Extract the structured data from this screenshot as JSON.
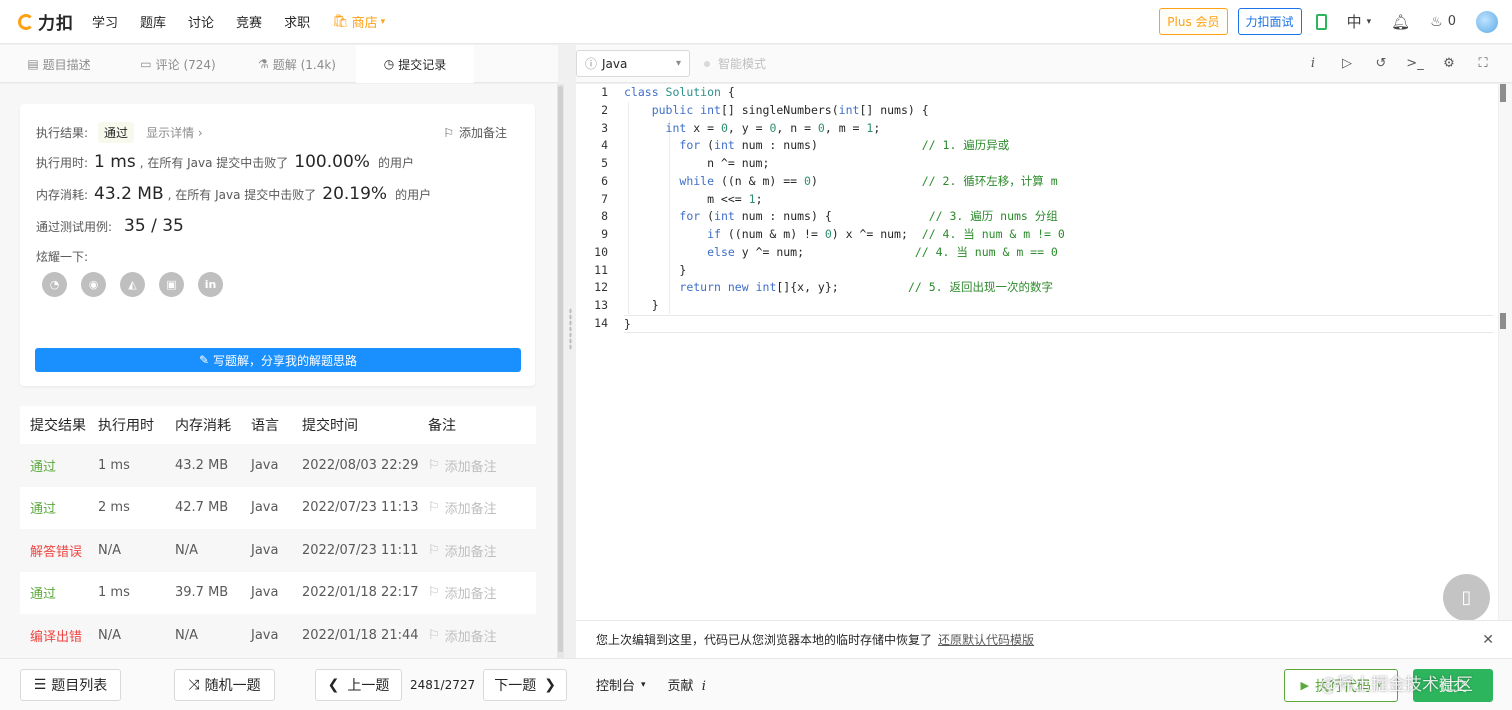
{
  "nav": {
    "logo_text": "力扣",
    "links": [
      "学习",
      "题库",
      "讨论",
      "竞赛",
      "求职"
    ],
    "store": "商店",
    "plus": "Plus 会员",
    "interview": "力扣面试",
    "lang": "中",
    "streak": "0"
  },
  "left_tabs": [
    {
      "label": "题目描述"
    },
    {
      "label": "评论 (724)"
    },
    {
      "label": "题解 (1.4k)"
    },
    {
      "label": "提交记录"
    }
  ],
  "result": {
    "result_label": "执行结果:",
    "status": "通过",
    "show_detail": "显示详情 ›",
    "add_note": "添加备注",
    "time_label": "执行用时:",
    "time_value": "1 ms",
    "time_text": ", 在所有 Java 提交中击败了",
    "time_pct": "100.00%",
    "time_suffix": "的用户",
    "mem_label": "内存消耗:",
    "mem_value": "43.2 MB",
    "mem_text": ", 在所有 Java 提交中击败了",
    "mem_pct": "20.19%",
    "mem_suffix": "的用户",
    "tests_label": "通过测试用例:",
    "tests_value": "35 / 35",
    "share_label": "炫耀一下:",
    "write_solution": "写题解，分享我的解题思路"
  },
  "submissions": {
    "headers": [
      "提交结果",
      "执行用时",
      "内存消耗",
      "语言",
      "提交时间",
      "备注"
    ],
    "rows": [
      {
        "status": "通过",
        "time": "1 ms",
        "mem": "43.2 MB",
        "lang": "Java",
        "date": "2022/08/03 22:29",
        "note": "添加备注"
      },
      {
        "status": "通过",
        "time": "2 ms",
        "mem": "42.7 MB",
        "lang": "Java",
        "date": "2022/07/23 11:13",
        "note": "添加备注"
      },
      {
        "status": "解答错误",
        "time": "N/A",
        "mem": "N/A",
        "lang": "Java",
        "date": "2022/07/23 11:11",
        "note": "添加备注"
      },
      {
        "status": "通过",
        "time": "1 ms",
        "mem": "39.7 MB",
        "lang": "Java",
        "date": "2022/01/18 22:17",
        "note": "添加备注"
      },
      {
        "status": "编译出错",
        "time": "N/A",
        "mem": "N/A",
        "lang": "Java",
        "date": "2022/01/18 21:44",
        "note": "添加备注"
      }
    ]
  },
  "bottom": {
    "problem_list": "题目列表",
    "random": "随机一题",
    "prev": "上一题",
    "pager": "2481/2727",
    "next": "下一题"
  },
  "editor": {
    "language": "Java",
    "smart_mode": "智能模式",
    "line_numbers": [
      "1",
      "2",
      "3",
      "4",
      "5",
      "6",
      "7",
      "8",
      "9",
      "10",
      "11",
      "12",
      "13",
      "14"
    ],
    "restore_text": "您上次编辑到这里，代码已从您浏览器本地的临时存储中恢复了",
    "restore_link": "还原默认代码模版",
    "console": "控制台",
    "contribute": "贡献",
    "run": "执行代码",
    "submit": "提交",
    "watermark": "@稀土掘金技术社区"
  },
  "colors": {
    "accent": "#ffa116",
    "pass": "#5ba93c",
    "fail": "#ef4743",
    "primary_blue": "#1a90ff",
    "submit_green": "#2db55d"
  }
}
